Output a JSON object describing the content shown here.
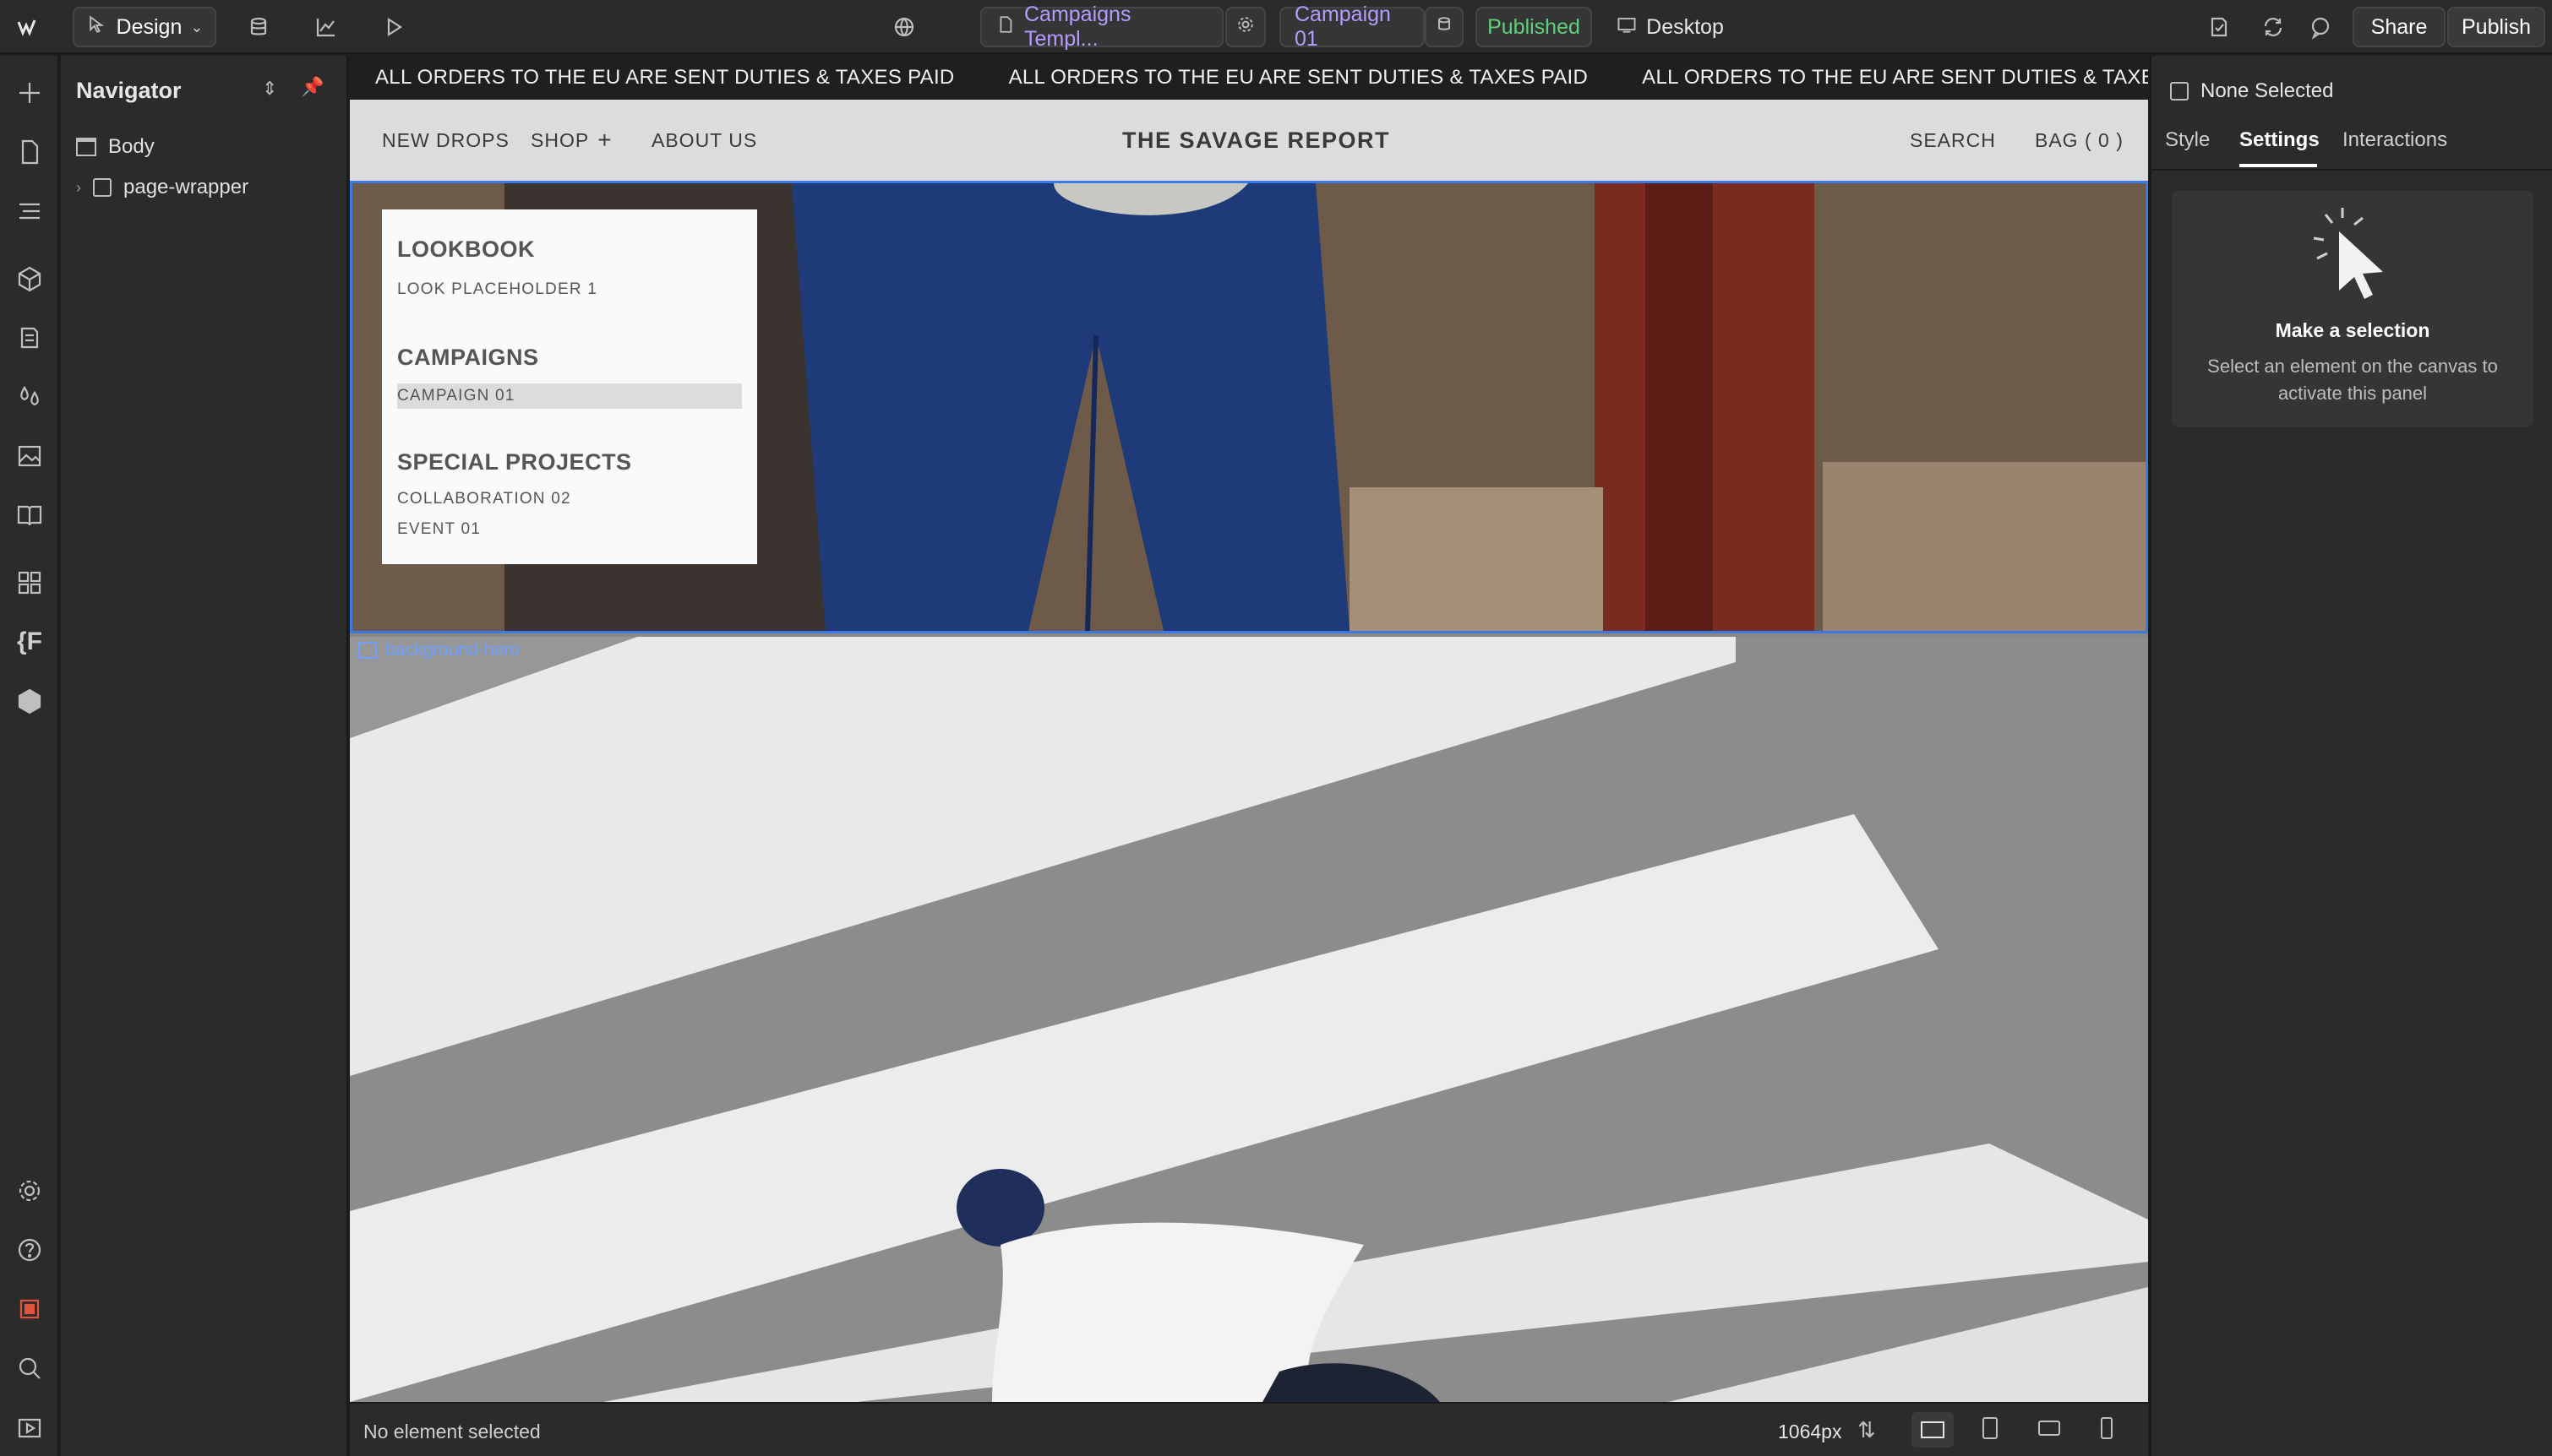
{
  "topbar": {
    "mode_label": "Design",
    "page_name": "Campaigns Templ...",
    "item_name": "Campaign 01",
    "status_badge": "Published",
    "breakpoint_label": "Desktop",
    "share_label": "Share",
    "publish_label": "Publish"
  },
  "navigator": {
    "title": "Navigator",
    "items": [
      {
        "label": "Body"
      },
      {
        "label": "page-wrapper"
      }
    ]
  },
  "canvas": {
    "ticker_text": "ALL ORDERS TO THE EU ARE SENT DUTIES & TAXES PAID",
    "ticker_partial": "A",
    "site_nav": {
      "new_drops": "NEW DROPS",
      "shop": "SHOP",
      "about": "ABOUT US",
      "brand": "THE SAVAGE REPORT",
      "search": "SEARCH",
      "bag": "BAG ( 0 )"
    },
    "menu": {
      "lookbook": "LOOKBOOK",
      "look_placeholder": "LOOK PLACEHOLDER 1",
      "campaigns": "CAMPAIGNS",
      "campaign_01": "CAMPAIGN 01",
      "special_projects": "SPECIAL PROJECTS",
      "collaboration": "COLLABORATION 02",
      "event": "EVENT 01"
    },
    "image_label": "background-hero"
  },
  "statusbar": {
    "selection_text": "No element selected",
    "width_value": "1064px"
  },
  "right_panel": {
    "none_selected": "None Selected",
    "tabs": [
      "Style",
      "Settings",
      "Interactions"
    ],
    "active_tab": "Settings",
    "card_title": "Make a selection",
    "card_body": "Select an element on the canvas to activate this panel"
  },
  "colors": {
    "selection_outline": "#3b79e6",
    "published_green": "#5fcf7a",
    "accent_purple": "#b49cff"
  }
}
